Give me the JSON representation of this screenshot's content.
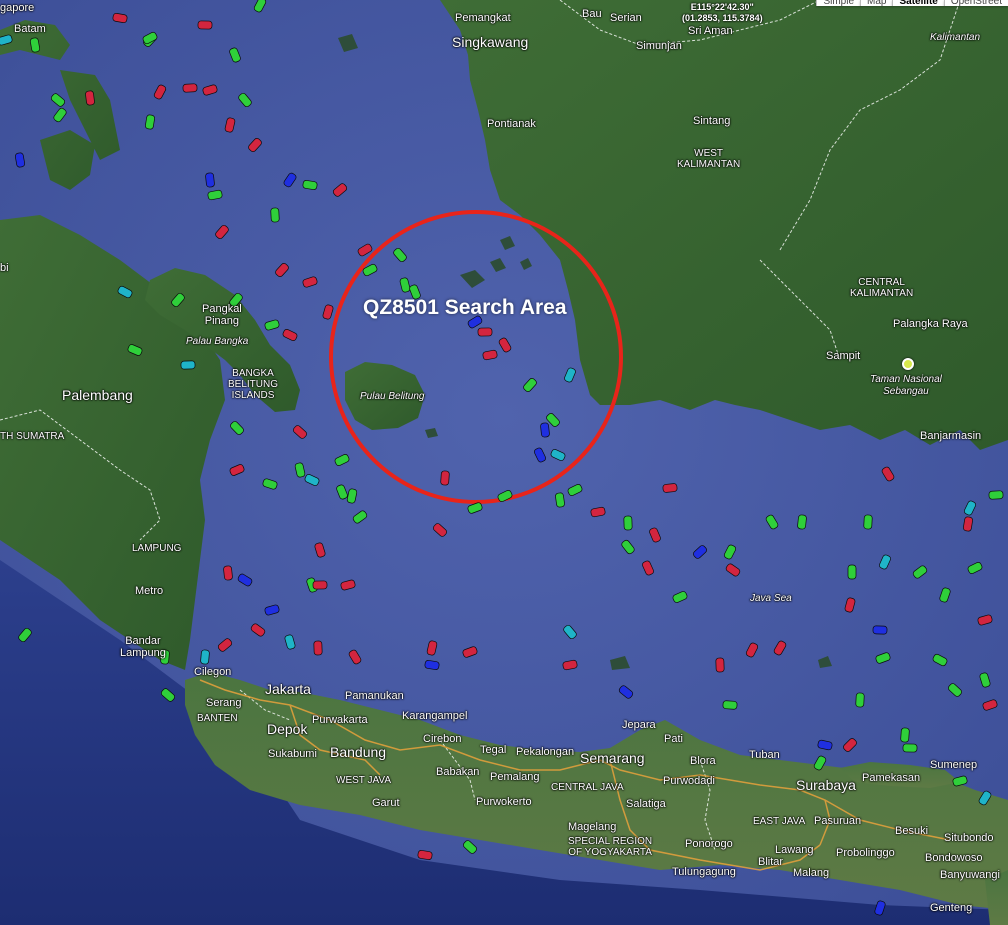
{
  "overlay": {
    "title": "QZ8501 Search Area",
    "circle_color": "#e8241a"
  },
  "coordinate_readout": "E115°22'42.30\"\n(01.2853, 115.3784)",
  "map_type_buttons": [
    "Simple",
    "Map",
    "Satellite",
    "OpenStreet"
  ],
  "map_type_active": "Satellite",
  "places": {
    "singapore": "gapore",
    "batam": "Batam",
    "bau": "Bau",
    "serian": "Serian",
    "sri_aman": "Sri Aman",
    "simunjan": "Simunjan",
    "pemangkat": "Pemangkat",
    "singkawang": "Singkawang",
    "kalimantan": "Kalimantan",
    "pontianak": "Pontianak",
    "sintang": "Sintang",
    "west_kalimantan": "WEST\nKALIMANTAN",
    "central_kalimantan": "CENTRAL\nKALIMANTAN",
    "palangka_raya": "Palangka Raya",
    "sampit": "Sampit",
    "taman_nasional": "Taman Nasional\nSebangau",
    "banjarmasin": "Banjarmasin",
    "jambi": "bi",
    "pangkal_pinang": "Pangkal\nPinang",
    "palau_bangka": "Palau Bangka",
    "bangka_belitung": "BANGKA\nBELITUNG\nISLANDS",
    "pulau_belitung": "Pulau Belitung",
    "palembang": "Palembang",
    "south_sumatra": "TH SUMATRA",
    "lampung": "LAMPUNG",
    "metro": "Metro",
    "bandar_lampung": "Bandar\nLampung",
    "cilegon": "Cilegon",
    "serang": "Serang",
    "banten": "BANTEN",
    "jakarta": "Jakarta",
    "depok": "Depok",
    "pamanukan": "Pamanukan",
    "purwakarta": "Purwakarta",
    "karangampel": "Karangampel",
    "sukabumi": "Sukabumi",
    "bandung": "Bandung",
    "west_java": "WEST JAVA",
    "garut": "Garut",
    "cirebon": "Cirebon",
    "babakan": "Babakan",
    "tegal": "Tegal",
    "pekalongan": "Pekalongan",
    "pemalang": "Pemalang",
    "semarang": "Semarang",
    "central_java": "CENTRAL JAVA",
    "purwokerto": "Purwokerto",
    "salatiga": "Salatiga",
    "magelang": "Magelang",
    "special_region": "SPECIAL REGION\nOF YOGYAKARTA",
    "jepara": "Jepara",
    "pati": "Pati",
    "blora": "Blora",
    "purwodadi": "Purwodadi",
    "tuban": "Tuban",
    "surabaya": "Surabaya",
    "east_java": "EAST JAVA",
    "pasuruan": "Pasuruan",
    "ponorogo": "Ponorogo",
    "lawang": "Lawang",
    "blitar": "Blitar",
    "malang": "Malang",
    "probolinggo": "Probolinggo",
    "tulungagung": "Tulungagung",
    "java_sea": "Java Sea",
    "pamekasan": "Pamekasan",
    "sumenep": "Sumenep",
    "besuki": "Besuki",
    "situbondo": "Situbondo",
    "bondowoso": "Bondowoso",
    "banyuwangi": "Banyuwangi",
    "genteng": "Genteng"
  },
  "colors": {
    "sea": "#4b5fa6",
    "land": "#3f6b36",
    "ship_cargo": "#2fcf3a",
    "ship_tanker": "#d3253f",
    "ship_passenger": "#1f2fe0",
    "ship_tug": "#1fb4c8"
  },
  "vessel_counts_note": ""
}
